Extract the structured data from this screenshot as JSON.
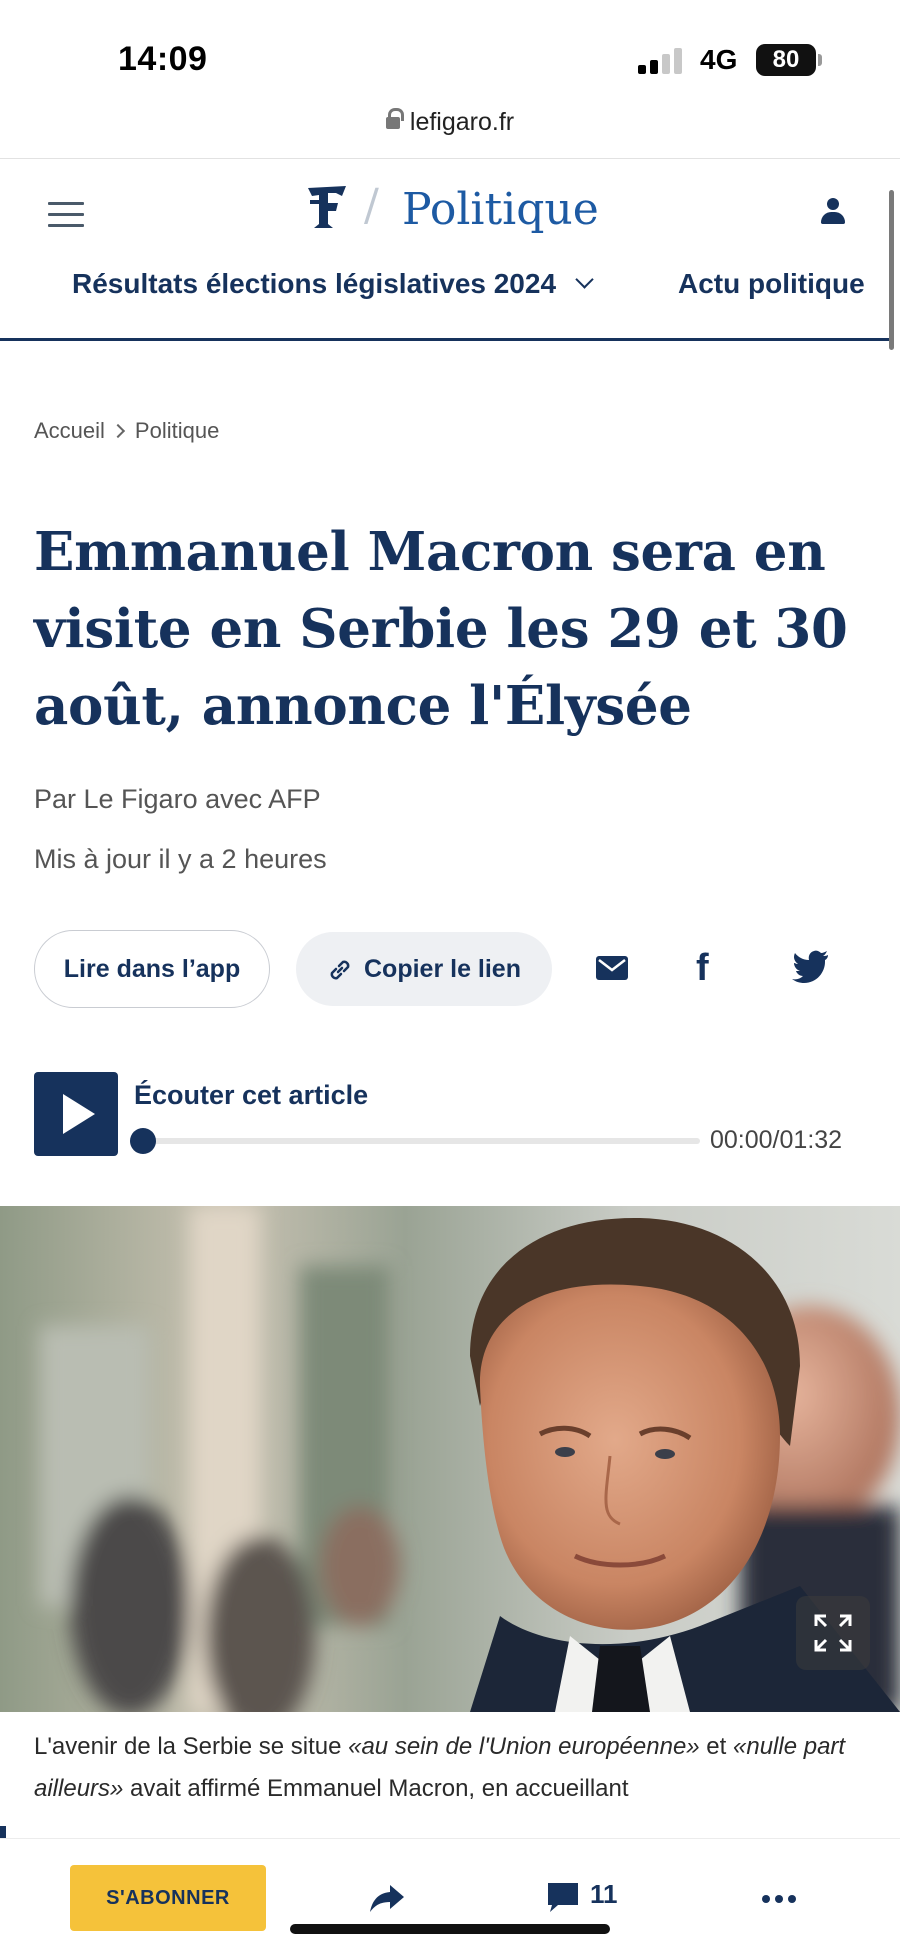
{
  "status_bar": {
    "time": "14:09",
    "network": "4G",
    "battery": "80"
  },
  "browser": {
    "url": "lefigaro.fr"
  },
  "header": {
    "section_title": "Politique",
    "subnav": [
      {
        "label": "Résultats élections législatives 2024"
      },
      {
        "label": "Actu politique"
      }
    ]
  },
  "article": {
    "breadcrumb": [
      "Accueil",
      "Politique"
    ],
    "headline": "Emmanuel Macron sera en visite en Serbie les 29 et 30 août, annonce l'Élysée",
    "byline": "Par Le Figaro avec AFP",
    "updated": "Mis à jour il y a 2 heures",
    "actions": {
      "read_in_app": "Lire dans l’app",
      "copy_link": "Copier le lien"
    },
    "audio": {
      "title": "Écouter cet article",
      "time": "00:00/01:32",
      "progress": 0
    },
    "caption": {
      "part1": "L'avenir de la Serbie se situe ",
      "quote1": "«au sein de l'Union européenne»",
      "part2": " et ",
      "quote2": "«nulle part ailleurs»",
      "part3": " avait affirmé Emmanuel Macron, en accueillant"
    }
  },
  "bottom_bar": {
    "subscribe": "S'ABONNER",
    "comment_count": "11"
  },
  "colors": {
    "navy": "#16325c",
    "section_blue": "#1d5aa3",
    "subscribe_yellow": "#f5c23a"
  },
  "icons": [
    "lock-icon",
    "menu-icon",
    "logo-f-icon",
    "user-icon",
    "chevron-down-icon",
    "link-icon",
    "mail-icon",
    "facebook-icon",
    "twitter-icon",
    "play-icon",
    "expand-icon",
    "share-icon",
    "comment-icon",
    "more-icon"
  ]
}
